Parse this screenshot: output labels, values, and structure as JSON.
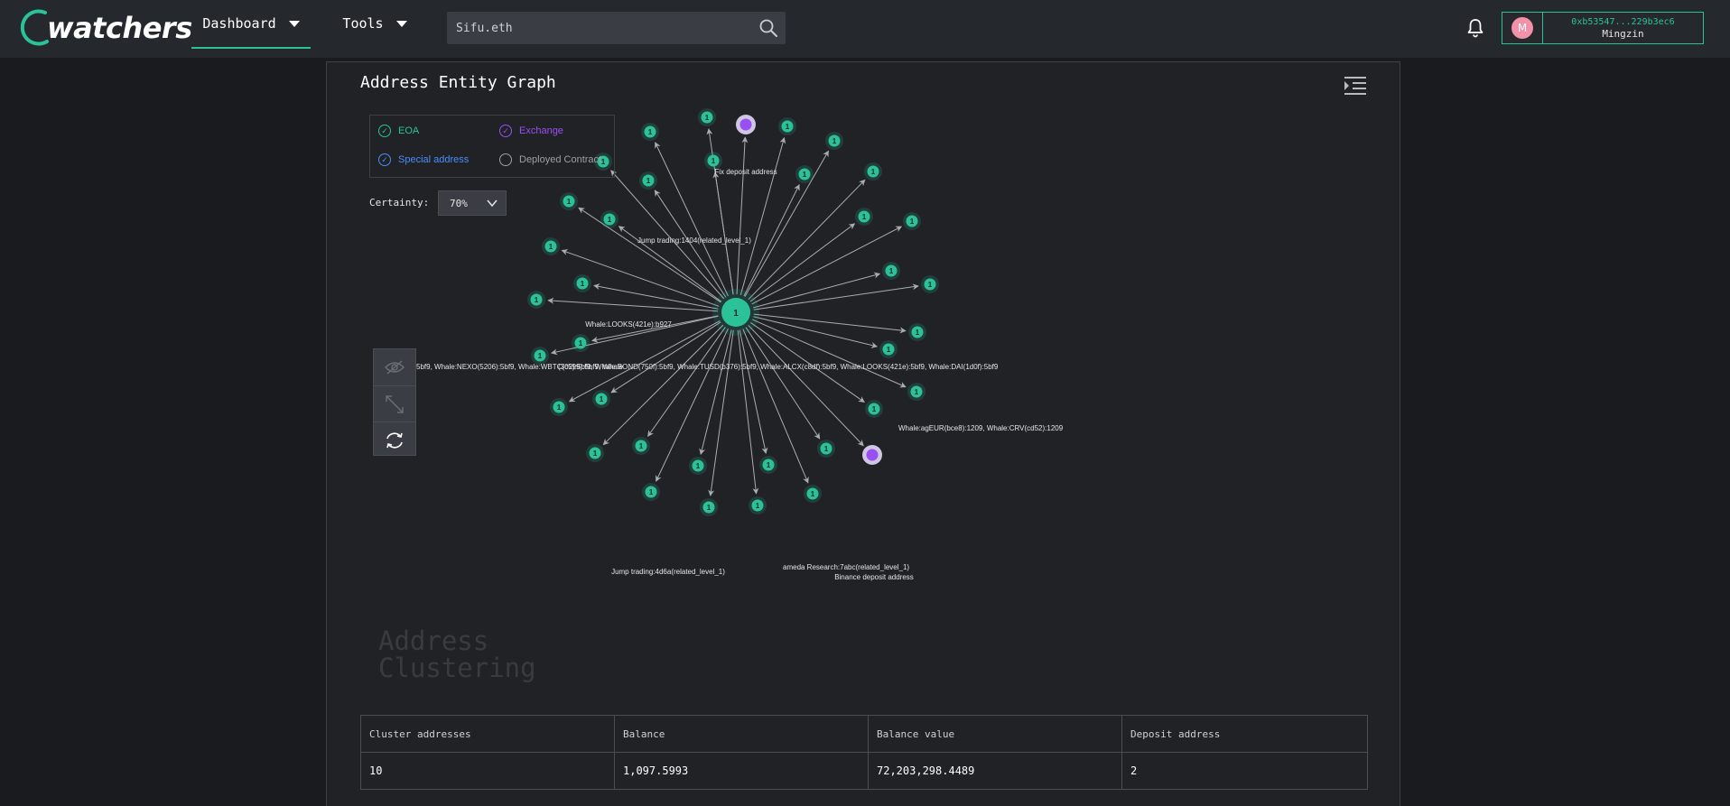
{
  "app": {
    "brand": "watchers",
    "brand_color": "#2bc29a"
  },
  "nav": {
    "dashboard_label": "Dashboard",
    "tools_label": "Tools",
    "search_value": "Sifu.eth",
    "search_placeholder": "Sifu.eth"
  },
  "account": {
    "avatar_initial": "M",
    "address": "0xb53547...229b3ec6",
    "username": "Mingzin"
  },
  "panel": {
    "title": "Address Entity Graph",
    "watermark_line1": "Address",
    "watermark_line2": "Clustering"
  },
  "legend": {
    "eoa": "EOA",
    "exchange": "Exchange",
    "special": "Special address",
    "deployed": "Deployed Contract",
    "colors": {
      "eoa": "#2bc29a",
      "exchange": "#9a4ff0",
      "special": "#4c8df5",
      "deployed": "#9ba0a6"
    }
  },
  "certainty": {
    "label": "Certainty:",
    "value": "70%"
  },
  "graph": {
    "center_label": "1",
    "node_badge": "1",
    "labels": {
      "fix_deposit": "Fix deposit address",
      "jump_1404": "Jump trading:1404(related_level_1)",
      "whale_looks_b927": "Whale:LOOKS(421e):b927",
      "whale_row_left": "5bf9,  Whale:NEXO(5206):5bf9,  Whale:WBTC(c599):5bf9,  Whale",
      "whale_row_right": "(302):5bf9,  Whale:BOND(750f):5bf9,  Whale:TUSD(b376):5bf9,  Whale:ALCX(c8df):5bf9,  Whale:LOOKS(421e):5bf9,  Whale:DAI(1d0f):5bf9",
      "whale_eur_crv": "Whale:agEUR(bce8):1209,  Whale:CRV(cd52):1209",
      "alameda": "ameda Research:7abc(related_level_1)",
      "binance_deposit": "Binance deposit address",
      "jump_4d6a": "Jump trading:4d6a(related_level_1)"
    }
  },
  "stats": {
    "headers": [
      "Cluster addresses",
      "Balance",
      "Balance value",
      "Deposit address"
    ],
    "values": [
      "10",
      "1,097.5993",
      "72,203,298.4489",
      "2"
    ]
  }
}
